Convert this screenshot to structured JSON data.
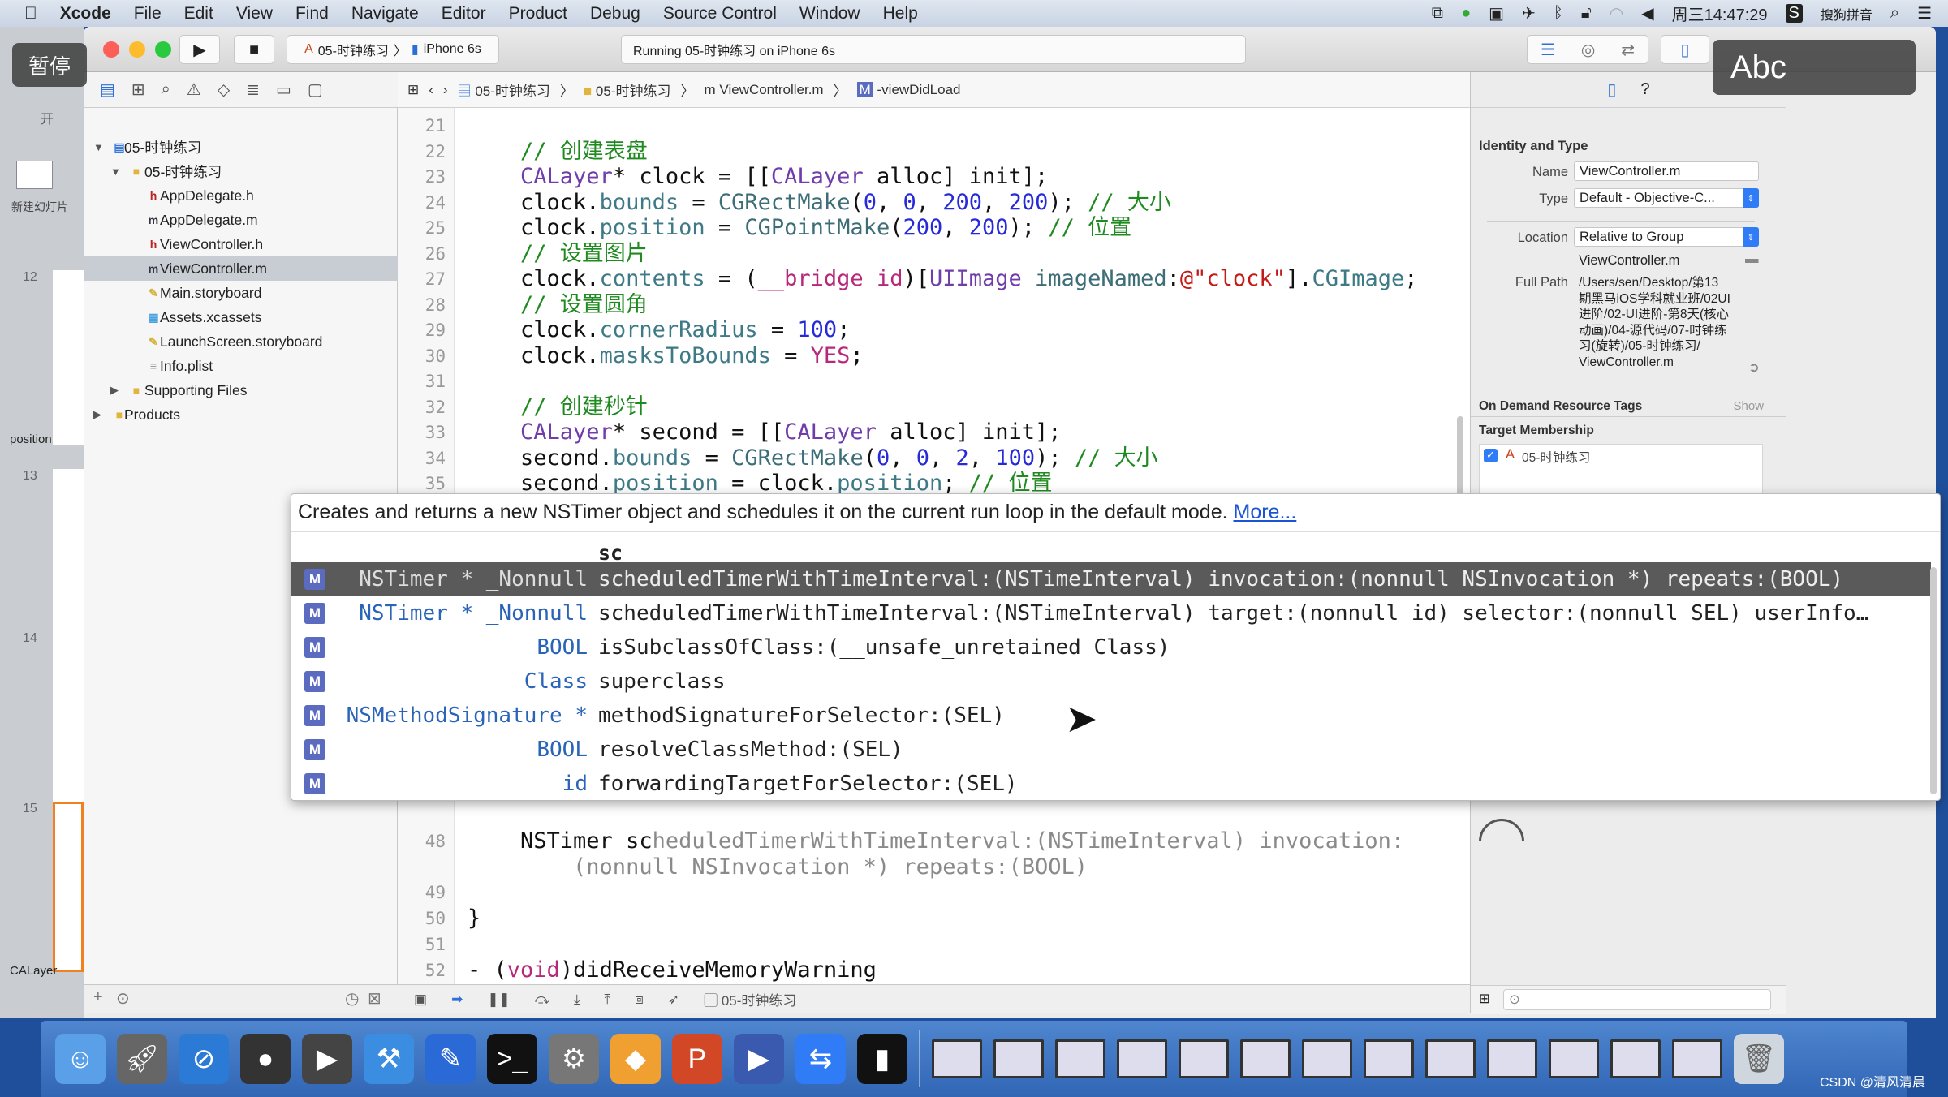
{
  "menubar": {
    "app": "Xcode",
    "items": [
      "File",
      "Edit",
      "View",
      "Find",
      "Navigate",
      "Editor",
      "Product",
      "Debug",
      "Source Control",
      "Window",
      "Help"
    ],
    "clock": "周三14:47:29",
    "input_method": "搜狗拼音",
    "status_icons": [
      "screen-mirror-icon",
      "green-app-icon",
      "video-record-icon",
      "airplane-icon",
      "bluetooth-icon",
      "lock-icon",
      "wifi-icon",
      "volume-icon"
    ]
  },
  "overlays": {
    "pause": "暂停",
    "input_hint": "Abc"
  },
  "powerpoint": {
    "tab_home": "开",
    "new_slide": "新建幻灯片",
    "slide_numbers": [
      "12",
      "13",
      "14",
      "15"
    ],
    "section_position": "position",
    "section_calayer": "CALayer"
  },
  "toolbar": {
    "scheme": "05-时钟练习",
    "device": "iPhone 6s",
    "activity": "Running 05-时钟练习 on iPhone 6s"
  },
  "jumpbar": {
    "items": [
      "05-时钟练习",
      "05-时钟练习",
      "ViewController.m",
      "-viewDidLoad"
    ]
  },
  "navigator": {
    "items": [
      {
        "label": "05-时钟练习",
        "icon": "project",
        "level": 0,
        "expanded": true
      },
      {
        "label": "05-时钟练习",
        "icon": "folder",
        "level": 1,
        "expanded": true
      },
      {
        "label": "AppDelegate.h",
        "icon": "h",
        "level": 2
      },
      {
        "label": "AppDelegate.m",
        "icon": "m",
        "level": 2
      },
      {
        "label": "ViewController.h",
        "icon": "h",
        "level": 2
      },
      {
        "label": "ViewController.m",
        "icon": "m",
        "level": 2,
        "selected": true
      },
      {
        "label": "Main.storyboard",
        "icon": "storyboard",
        "level": 2
      },
      {
        "label": "Assets.xcassets",
        "icon": "assets",
        "level": 2
      },
      {
        "label": "LaunchScreen.storyboard",
        "icon": "storyboard",
        "level": 2
      },
      {
        "label": "Info.plist",
        "icon": "plist",
        "level": 2
      },
      {
        "label": "Supporting Files",
        "icon": "folder",
        "level": 1,
        "expanded": false,
        "sub": true
      },
      {
        "label": "Products",
        "icon": "folder",
        "level": 0,
        "expanded": false,
        "sub": true
      }
    ]
  },
  "editor": {
    "lines": [
      {
        "n": "21",
        "tokens": []
      },
      {
        "n": "22",
        "tokens": [
          [
            "    // 创建表盘",
            "comment"
          ]
        ]
      },
      {
        "n": "23",
        "tokens": [
          [
            "    ",
            "plain"
          ],
          [
            "CALayer",
            "class"
          ],
          [
            "* clock = [[",
            "plain"
          ],
          [
            "CALayer",
            "class"
          ],
          [
            " alloc] init];",
            "plain"
          ]
        ]
      },
      {
        "n": "24",
        "tokens": [
          [
            "    clock.",
            "plain"
          ],
          [
            "bounds",
            "prop"
          ],
          [
            " = ",
            "plain"
          ],
          [
            "CGRectMake",
            "func"
          ],
          [
            "(",
            "plain"
          ],
          [
            "0",
            "num"
          ],
          [
            ", ",
            "plain"
          ],
          [
            "0",
            "num"
          ],
          [
            ", ",
            "plain"
          ],
          [
            "200",
            "num"
          ],
          [
            ", ",
            "plain"
          ],
          [
            "200",
            "num"
          ],
          [
            "); ",
            "plain"
          ],
          [
            "// 大小",
            "comment"
          ]
        ]
      },
      {
        "n": "25",
        "tokens": [
          [
            "    clock.",
            "plain"
          ],
          [
            "position",
            "prop"
          ],
          [
            " = ",
            "plain"
          ],
          [
            "CGPointMake",
            "func"
          ],
          [
            "(",
            "plain"
          ],
          [
            "200",
            "num"
          ],
          [
            ", ",
            "plain"
          ],
          [
            "200",
            "num"
          ],
          [
            "); ",
            "plain"
          ],
          [
            "// 位置",
            "comment"
          ]
        ]
      },
      {
        "n": "26",
        "tokens": [
          [
            "    // 设置图片",
            "comment"
          ]
        ]
      },
      {
        "n": "27",
        "tokens": [
          [
            "    clock.",
            "plain"
          ],
          [
            "contents",
            "prop"
          ],
          [
            " = (",
            "plain"
          ],
          [
            "__bridge",
            "kw"
          ],
          [
            " ",
            "plain"
          ],
          [
            "id",
            "kw"
          ],
          [
            ")[",
            "plain"
          ],
          [
            "UIImage",
            "class"
          ],
          [
            " ",
            "plain"
          ],
          [
            "imageNamed",
            "func"
          ],
          [
            ":",
            "plain"
          ],
          [
            "@\"clock\"",
            "str"
          ],
          [
            "].",
            "plain"
          ],
          [
            "CGImage",
            "prop"
          ],
          [
            ";",
            "plain"
          ]
        ]
      },
      {
        "n": "28",
        "tokens": [
          [
            "    // 设置圆角",
            "comment"
          ]
        ]
      },
      {
        "n": "29",
        "tokens": [
          [
            "    clock.",
            "plain"
          ],
          [
            "cornerRadius",
            "prop"
          ],
          [
            " = ",
            "plain"
          ],
          [
            "100",
            "num"
          ],
          [
            ";",
            "plain"
          ]
        ]
      },
      {
        "n": "30",
        "tokens": [
          [
            "    clock.",
            "plain"
          ],
          [
            "masksToBounds",
            "prop"
          ],
          [
            " = ",
            "plain"
          ],
          [
            "YES",
            "kw"
          ],
          [
            ";",
            "plain"
          ]
        ]
      },
      {
        "n": "31",
        "tokens": []
      },
      {
        "n": "32",
        "tokens": [
          [
            "    // 创建秒针",
            "comment"
          ]
        ]
      },
      {
        "n": "33",
        "tokens": [
          [
            "    ",
            "plain"
          ],
          [
            "CALayer",
            "class"
          ],
          [
            "* second = [[",
            "plain"
          ],
          [
            "CALayer",
            "class"
          ],
          [
            " alloc] init];",
            "plain"
          ]
        ]
      },
      {
        "n": "34",
        "tokens": [
          [
            "    second.",
            "plain"
          ],
          [
            "bounds",
            "prop"
          ],
          [
            " = ",
            "plain"
          ],
          [
            "CGRectMake",
            "func"
          ],
          [
            "(",
            "plain"
          ],
          [
            "0",
            "num"
          ],
          [
            ", ",
            "plain"
          ],
          [
            "0",
            "num"
          ],
          [
            ", ",
            "plain"
          ],
          [
            "2",
            "num"
          ],
          [
            ", ",
            "plain"
          ],
          [
            "100",
            "num"
          ],
          [
            "); ",
            "plain"
          ],
          [
            "// 大小",
            "comment"
          ]
        ]
      },
      {
        "n": "35",
        "tokens": [
          [
            "    second.",
            "plain"
          ],
          [
            "position",
            "prop"
          ],
          [
            " = clock.",
            "plain"
          ],
          [
            "position",
            "prop"
          ],
          [
            "; ",
            "plain"
          ],
          [
            "// 位置",
            "comment"
          ]
        ]
      }
    ],
    "lines_after": [
      {
        "n": "48",
        "tokens": [
          [
            "    NSTimer sc",
            "plain"
          ],
          [
            "heduledTimerWithTimeInterval:(NSTimeInterval) invocation:",
            "ph"
          ]
        ]
      },
      {
        "n": "",
        "tokens": [
          [
            "        (nonnull NSInvocation *) repeats:(BOOL)",
            "ph"
          ]
        ]
      },
      {
        "n": "49",
        "tokens": []
      },
      {
        "n": "50",
        "tokens": [
          [
            "}",
            "plain"
          ]
        ]
      },
      {
        "n": "51",
        "tokens": []
      },
      {
        "n": "52",
        "tokens": [
          [
            "- (",
            "plain"
          ],
          [
            "void",
            "kw"
          ],
          [
            ")didReceiveMemoryWarning",
            "plain"
          ]
        ]
      },
      {
        "n": "53",
        "tokens": [
          [
            "{",
            "plain"
          ]
        ]
      }
    ]
  },
  "completion": {
    "description": "Creates and returns a new NSTimer object and schedules it on the current run loop in the default mode.",
    "more_link": "More...",
    "typed": "sc",
    "badge": "M",
    "items": [
      {
        "type": "NSTimer * _Nonnull",
        "name": "scheduledTimerWithTimeInterval:(NSTimeInterval) invocation:(nonnull NSInvocation *) repeats:(BOOL)",
        "selected": true
      },
      {
        "type": "NSTimer * _Nonnull",
        "name": "scheduledTimerWithTimeInterval:(NSTimeInterval) target:(nonnull id) selector:(nonnull SEL) userInfo…"
      },
      {
        "type": "BOOL",
        "name": "isSubclassOfClass:(__unsafe_unretained Class)"
      },
      {
        "type": "Class",
        "name": "superclass"
      },
      {
        "type": "NSMethodSignature *",
        "name": "methodSignatureForSelector:(SEL)"
      },
      {
        "type": "BOOL",
        "name": "resolveClassMethod:(SEL)"
      },
      {
        "type": "id",
        "name": "forwardingTargetForSelector:(SEL)"
      }
    ]
  },
  "debugbar": {
    "target": "05-时钟练习"
  },
  "inspector": {
    "section_identity": "Identity and Type",
    "name_label": "Name",
    "name_value": "ViewController.m",
    "type_label": "Type",
    "type_value": "Default - Objective-C...",
    "location_label": "Location",
    "location_value": "Relative to Group",
    "location_file": "ViewController.m",
    "fullpath_label": "Full Path",
    "fullpath_lines": [
      "/Users/sen/Desktop/第13",
      "期黑马iOS学科就业班/02UI",
      "进阶/02-UI进阶-第8天(核心",
      "动画)/04-源代码/07-时钟练",
      "习(旋转)/05-时钟练习/",
      "ViewController.m"
    ],
    "section_tags": "On Demand Resource Tags",
    "tags_show": "Show",
    "section_target": "Target Membership",
    "target_name": "05-时钟练习",
    "target_checked": true
  },
  "dock": {
    "apps": [
      "finder",
      "launchpad",
      "safari",
      "mouse",
      "photo-booth",
      "xcode",
      "xcode-instruments",
      "terminal",
      "system-preferences",
      "sketch",
      "powerpoint",
      "quicktime",
      "teamviewer",
      "console"
    ],
    "watermark": "CSDN @清风清晨"
  }
}
